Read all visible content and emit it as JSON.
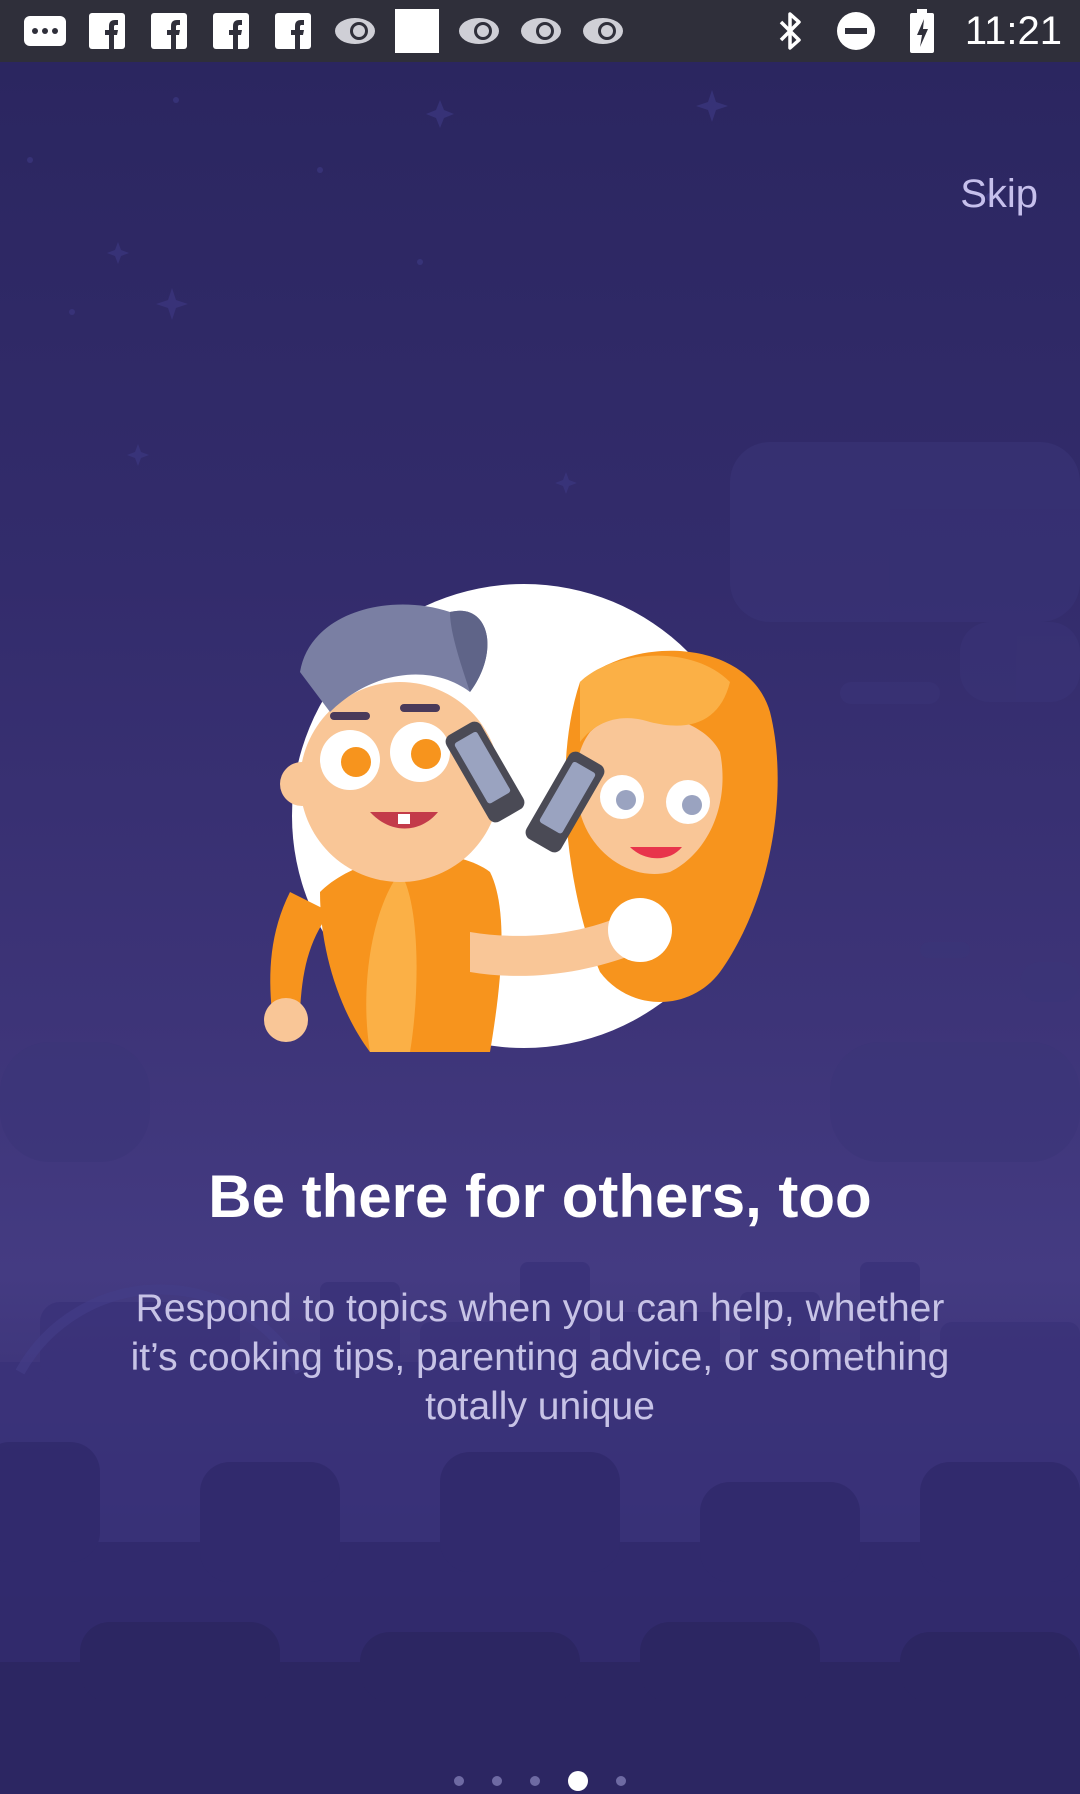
{
  "status_bar": {
    "time": "11:21",
    "notification_icons": [
      "message-icon",
      "facebook-icon",
      "facebook-icon",
      "facebook-icon",
      "facebook-icon",
      "abc13-icon",
      "image-icon",
      "abc13-icon",
      "abc13-icon",
      "abc13-icon"
    ],
    "system_icons": [
      "bluetooth-icon",
      "do-not-disturb-icon",
      "battery-icon"
    ]
  },
  "header": {
    "skip_label": "Skip"
  },
  "onboarding": {
    "title": "Be there for others, too",
    "description": "Respond to topics when you can help, whether it’s cooking tips, parenting advice, or something totally unique"
  },
  "pager": {
    "total": 5,
    "active_index": 3
  },
  "colors": {
    "background": "#2a255f",
    "accent_orange": "#f7941d",
    "text_primary": "#ffffff",
    "text_secondary": "#c7c3e6"
  }
}
